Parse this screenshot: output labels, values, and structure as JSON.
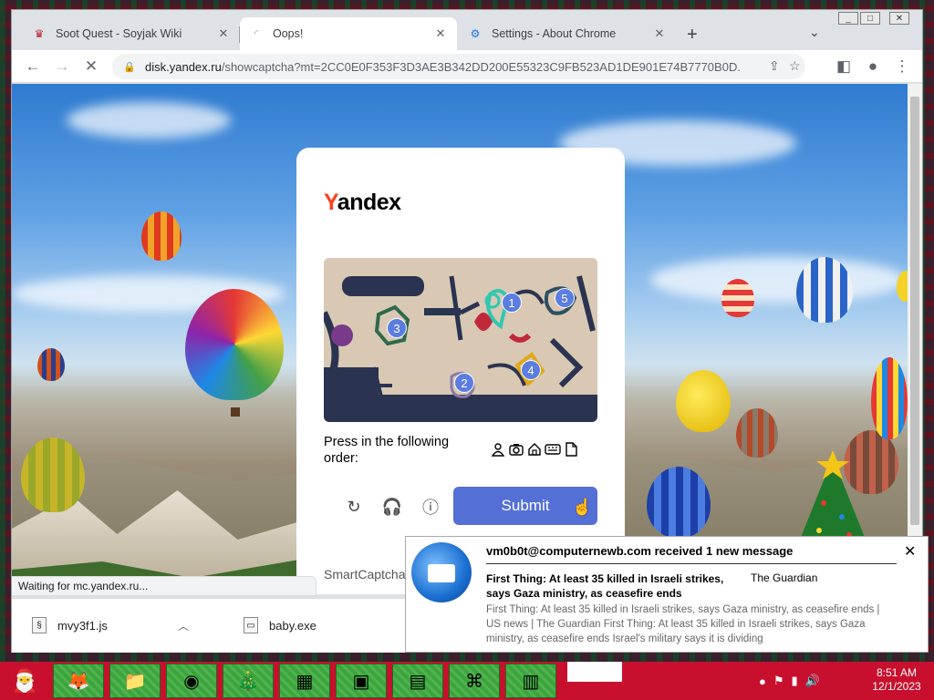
{
  "browser": {
    "tabs": [
      {
        "title": "Soot Quest - Soyjak Wiki",
        "active": false
      },
      {
        "title": "Oops!",
        "active": true
      },
      {
        "title": "Settings - About Chrome",
        "active": false
      }
    ],
    "address": {
      "host": "disk.yandex.ru",
      "path": "/showcaptcha?mt=2CC0E0F353F3D3AE3B342DD200E55323C9FB523AD1DE901E74B7770B0D..."
    },
    "status_text": "Waiting for mc.yandex.ru..."
  },
  "captcha": {
    "logo_first_letter": "Y",
    "logo_rest": "andex",
    "markers": [
      "1",
      "2",
      "3",
      "4",
      "5"
    ],
    "instruction": "Press in the following order:",
    "order_icons": [
      "person-icon",
      "camera-icon",
      "house-icon",
      "keyboard-icon",
      "document-icon"
    ],
    "submit_label": "Submit",
    "footer": "SmartCaptcha"
  },
  "downloads": [
    {
      "name": "mvy3f1.js"
    },
    {
      "name": "baby.exe"
    }
  ],
  "notification": {
    "title": "vm0b0t@computernewb.com received 1 new message",
    "subject": "First Thing: At least 35 killed in Israeli strikes, says Gaza ministry, as ceasefire ends",
    "sender": "The Guardian",
    "preview": "First Thing: At least 35 killed in Israeli strikes, says Gaza ministry, as ceasefire ends | US news | The Guardian First Thing: At least 35 killed in Israeli strikes, says Gaza ministry, as ceasefire ends Israel's military says it is dividing"
  },
  "taskbar": {
    "apps": [
      "firefox-icon",
      "file-explorer-icon",
      "chrome-icon",
      "tree-icon",
      "calendar-icon",
      "image-viewer-icon",
      "notepad-icon",
      "network-icon",
      "control-panel-icon"
    ],
    "time": "8:51 AM",
    "date": "12/1/2023"
  },
  "colors": {
    "yandex_red": "#fc3f1d",
    "submit_blue": "#5470d6",
    "taskbar_red": "#c8102e",
    "taskbar_green": "#3aa63a"
  }
}
